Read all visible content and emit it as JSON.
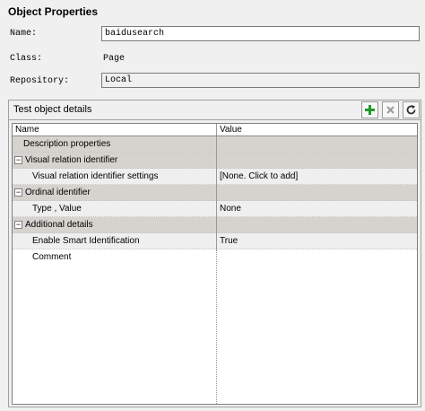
{
  "header": {
    "title": "Object Properties"
  },
  "form": {
    "name_label": "Name:",
    "name_value": "baidusearch",
    "class_label": "Class:",
    "class_value": "Page",
    "repository_label": "Repository:",
    "repository_value": "Local"
  },
  "details": {
    "group_title": "Test object details",
    "add_icon": "plus-icon",
    "remove_icon": "x-icon",
    "refresh_icon": "refresh-icon",
    "columns": {
      "name": "Name",
      "value": "Value"
    },
    "rows": [
      {
        "name": "Description properties",
        "value": ""
      },
      {
        "name": "Visual relation identifier",
        "value": "",
        "toggle": "−"
      },
      {
        "name": "Visual relation identifier settings",
        "value": "[None. Click to add]"
      },
      {
        "name": "Ordinal identifier",
        "value": "",
        "toggle": "−"
      },
      {
        "name": "Type , Value",
        "value": "None"
      },
      {
        "name": "Additional details",
        "value": "",
        "toggle": "−"
      },
      {
        "name": "Enable Smart Identification",
        "value": "True"
      },
      {
        "name": "Comment",
        "value": ""
      }
    ]
  },
  "colors": {
    "category_row": "#d6d3ce",
    "property_row": "#efefef",
    "add_icon": "#1e9a2a",
    "remove_icon": "#9a9a9a"
  }
}
